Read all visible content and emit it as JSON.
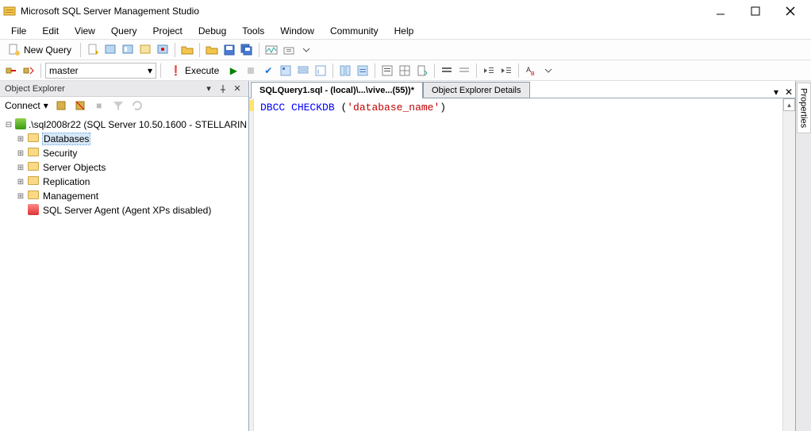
{
  "window": {
    "title": "Microsoft SQL Server Management Studio"
  },
  "menu": {
    "items": [
      "File",
      "Edit",
      "View",
      "Query",
      "Project",
      "Debug",
      "Tools",
      "Window",
      "Community",
      "Help"
    ]
  },
  "toolbar1": {
    "new_query": "New Query"
  },
  "toolbar2": {
    "database": "master",
    "execute": "Execute"
  },
  "object_explorer": {
    "title": "Object Explorer",
    "connect_label": "Connect",
    "root": ".\\sql2008r22 (SQL Server 10.50.1600 - STELLARIN",
    "nodes": [
      "Databases",
      "Security",
      "Server Objects",
      "Replication",
      "Management"
    ],
    "agent": "SQL Server Agent (Agent XPs disabled)"
  },
  "tabs": {
    "active": "SQLQuery1.sql - (local)\\...\\vive...(55))*",
    "inactive": "Object Explorer Details"
  },
  "editor": {
    "kw1": "DBCC",
    "kw2": "CHECKDB",
    "paren_open": " (",
    "str": "'database_name'",
    "paren_close": ")"
  },
  "properties": {
    "label": "Properties"
  }
}
